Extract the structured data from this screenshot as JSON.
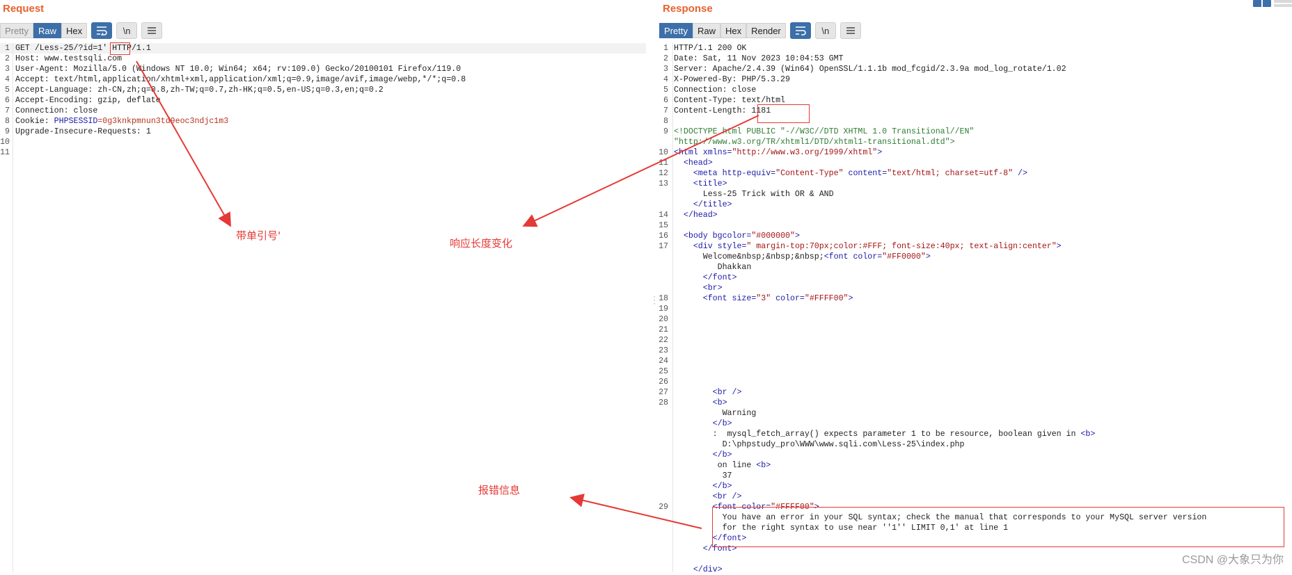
{
  "request": {
    "title": "Request",
    "tabs": {
      "pretty": "Pretty",
      "raw": "Raw",
      "hex": "Hex"
    },
    "tools": {
      "wrap": "wrap-lines-icon",
      "newline": "\\n",
      "menu": "menu-icon"
    },
    "lines": [
      {
        "n": "1",
        "parts": [
          {
            "t": "GET /Less-25/?id=1' HTTP/1.1"
          }
        ]
      },
      {
        "n": "2",
        "parts": [
          {
            "t": "Host: www.testsqli.com"
          }
        ]
      },
      {
        "n": "3",
        "parts": [
          {
            "t": "User-Agent: Mozilla/5.0 (Windows NT 10.0; Win64; x64; rv:109.0) Gecko/20100101 Firefox/119.0"
          }
        ]
      },
      {
        "n": "4",
        "parts": [
          {
            "t": "Accept: text/html,application/xhtml+xml,application/xml;q=0.9,image/avif,image/webp,*/*;q=0.8"
          }
        ]
      },
      {
        "n": "5",
        "parts": [
          {
            "t": "Accept-Language: zh-CN,zh;q=0.8,zh-TW;q=0.7,zh-HK;q=0.5,en-US;q=0.3,en;q=0.2"
          }
        ]
      },
      {
        "n": "6",
        "parts": [
          {
            "t": "Accept-Encoding: gzip, deflate"
          }
        ]
      },
      {
        "n": "7",
        "parts": [
          {
            "t": "Connection: close"
          }
        ]
      },
      {
        "n": "8",
        "parts": [
          {
            "t": "Cookie: "
          },
          {
            "t": "PHPSESSID",
            "c": "cookie-name"
          },
          {
            "t": "=0g3knkpmnun3td9eoc3ndjc1m3",
            "c": "cookie-val"
          }
        ]
      },
      {
        "n": "9",
        "parts": [
          {
            "t": "Upgrade-Insecure-Requests: 1"
          }
        ]
      },
      {
        "n": "10",
        "parts": []
      },
      {
        "n": "11",
        "parts": []
      }
    ]
  },
  "response": {
    "title": "Response",
    "tabs": {
      "pretty": "Pretty",
      "raw": "Raw",
      "hex": "Hex",
      "render": "Render"
    },
    "tools": {
      "wrap": "wrap-lines-icon",
      "newline": "\\n",
      "menu": "menu-icon"
    },
    "lines": [
      {
        "n": "1",
        "parts": [
          {
            "t": "HTTP/1.1 200 OK"
          }
        ]
      },
      {
        "n": "2",
        "parts": [
          {
            "t": "Date: Sat, 11 Nov 2023 10:04:53 GMT"
          }
        ]
      },
      {
        "n": "3",
        "parts": [
          {
            "t": "Server: Apache/2.4.39 (Win64) OpenSSL/1.1.1b mod_fcgid/2.3.9a mod_log_rotate/1.02"
          }
        ]
      },
      {
        "n": "4",
        "parts": [
          {
            "t": "X-Powered-By: PHP/5.3.29"
          }
        ]
      },
      {
        "n": "5",
        "parts": [
          {
            "t": "Connection: close"
          }
        ]
      },
      {
        "n": "6",
        "parts": [
          {
            "t": "Content-Type: text/html"
          }
        ]
      },
      {
        "n": "7",
        "parts": [
          {
            "t": "Content-Length: 1181"
          }
        ]
      },
      {
        "n": "8",
        "parts": []
      },
      {
        "n": "9",
        "parts": [
          {
            "t": "<!DOCTYPE html PUBLIC \"-//W3C//DTD XHTML 1.0 Transitional//EN\"",
            "c": "doctype"
          }
        ]
      },
      {
        "n": "",
        "parts": [
          {
            "t": "\"http://www.w3.org/TR/xhtml1/DTD/xhtml1-transitional.dtd\">",
            "c": "doctype"
          }
        ]
      },
      {
        "n": "10",
        "parts": [
          {
            "t": "<html ",
            "c": "tag"
          },
          {
            "t": "xmlns=",
            "c": "attr"
          },
          {
            "t": "\"http://www.w3.org/1999/xhtml\"",
            "c": "str"
          },
          {
            "t": ">",
            "c": "tag"
          }
        ]
      },
      {
        "n": "11",
        "parts": [
          {
            "t": "  "
          },
          {
            "t": "<head>",
            "c": "tag"
          }
        ]
      },
      {
        "n": "12",
        "parts": [
          {
            "t": "    "
          },
          {
            "t": "<meta ",
            "c": "tag"
          },
          {
            "t": "http-equiv=",
            "c": "attr"
          },
          {
            "t": "\"Content-Type\" ",
            "c": "str"
          },
          {
            "t": "content=",
            "c": "attr"
          },
          {
            "t": "\"text/html; charset=utf-8\"",
            "c": "str"
          },
          {
            "t": " />",
            "c": "tag"
          }
        ]
      },
      {
        "n": "13",
        "parts": [
          {
            "t": "    "
          },
          {
            "t": "<title>",
            "c": "tag"
          }
        ]
      },
      {
        "n": "",
        "parts": [
          {
            "t": "      Less-25 Trick with OR & AND"
          }
        ]
      },
      {
        "n": "",
        "parts": [
          {
            "t": "    "
          },
          {
            "t": "</title>",
            "c": "tag"
          }
        ]
      },
      {
        "n": "14",
        "parts": [
          {
            "t": "  "
          },
          {
            "t": "</head>",
            "c": "tag"
          }
        ]
      },
      {
        "n": "15",
        "parts": []
      },
      {
        "n": "16",
        "parts": [
          {
            "t": "  "
          },
          {
            "t": "<body ",
            "c": "tag"
          },
          {
            "t": "bgcolor=",
            "c": "attr"
          },
          {
            "t": "\"#000000\"",
            "c": "str"
          },
          {
            "t": ">",
            "c": "tag"
          }
        ]
      },
      {
        "n": "17",
        "parts": [
          {
            "t": "    "
          },
          {
            "t": "<div ",
            "c": "tag"
          },
          {
            "t": "style=",
            "c": "attr"
          },
          {
            "t": "\" margin-top:70px;color:#FFF; font-size:40px; text-align:center\"",
            "c": "str"
          },
          {
            "t": ">",
            "c": "tag"
          }
        ]
      },
      {
        "n": "",
        "parts": [
          {
            "t": "      Welcome&nbsp;&nbsp;&nbsp;"
          },
          {
            "t": "<font ",
            "c": "tag"
          },
          {
            "t": "color=",
            "c": "attr"
          },
          {
            "t": "\"#FF0000\"",
            "c": "str"
          },
          {
            "t": ">",
            "c": "tag"
          }
        ]
      },
      {
        "n": "",
        "parts": [
          {
            "t": "         Dhakkan"
          }
        ]
      },
      {
        "n": "",
        "parts": [
          {
            "t": "      "
          },
          {
            "t": "</font>",
            "c": "tag"
          }
        ]
      },
      {
        "n": "",
        "parts": [
          {
            "t": "      "
          },
          {
            "t": "<br>",
            "c": "tag"
          }
        ]
      },
      {
        "n": "18",
        "parts": [
          {
            "t": "      "
          },
          {
            "t": "<font ",
            "c": "tag"
          },
          {
            "t": "size=",
            "c": "attr"
          },
          {
            "t": "\"3\" ",
            "c": "str"
          },
          {
            "t": "color=",
            "c": "attr"
          },
          {
            "t": "\"#FFFF00\"",
            "c": "str"
          },
          {
            "t": ">",
            "c": "tag"
          }
        ]
      },
      {
        "n": "19",
        "parts": []
      },
      {
        "n": "20",
        "parts": []
      },
      {
        "n": "21",
        "parts": []
      },
      {
        "n": "22",
        "parts": []
      },
      {
        "n": "23",
        "parts": []
      },
      {
        "n": "24",
        "parts": []
      },
      {
        "n": "25",
        "parts": []
      },
      {
        "n": "26",
        "parts": []
      },
      {
        "n": "27",
        "parts": [
          {
            "t": "        "
          },
          {
            "t": "<br />",
            "c": "tag"
          }
        ]
      },
      {
        "n": "28",
        "parts": [
          {
            "t": "        "
          },
          {
            "t": "<b>",
            "c": "tag"
          }
        ]
      },
      {
        "n": "",
        "parts": [
          {
            "t": "          Warning"
          }
        ]
      },
      {
        "n": "",
        "parts": [
          {
            "t": "        "
          },
          {
            "t": "</b>",
            "c": "tag"
          }
        ]
      },
      {
        "n": "",
        "parts": [
          {
            "t": "        :  mysql_fetch_array() expects parameter 1 to be resource, boolean given in "
          },
          {
            "t": "<b>",
            "c": "tag"
          }
        ]
      },
      {
        "n": "",
        "parts": [
          {
            "t": "          D:\\phpstudy_pro\\WWW\\www.sqli.com\\Less-25\\index.php"
          }
        ]
      },
      {
        "n": "",
        "parts": [
          {
            "t": "        "
          },
          {
            "t": "</b>",
            "c": "tag"
          }
        ]
      },
      {
        "n": "",
        "parts": [
          {
            "t": "         on line "
          },
          {
            "t": "<b>",
            "c": "tag"
          }
        ]
      },
      {
        "n": "",
        "parts": [
          {
            "t": "          37"
          }
        ]
      },
      {
        "n": "",
        "parts": [
          {
            "t": "        "
          },
          {
            "t": "</b>",
            "c": "tag"
          }
        ]
      },
      {
        "n": "",
        "parts": [
          {
            "t": "        "
          },
          {
            "t": "<br />",
            "c": "tag"
          }
        ]
      },
      {
        "n": "29",
        "parts": [
          {
            "t": "        "
          },
          {
            "t": "<font ",
            "c": "tag"
          },
          {
            "t": "color=",
            "c": "attr"
          },
          {
            "t": "\"#FFFF00\"",
            "c": "str"
          },
          {
            "t": ">",
            "c": "tag"
          }
        ]
      },
      {
        "n": "",
        "parts": [
          {
            "t": "          You have an error in your SQL syntax; check the manual that corresponds to your MySQL server version"
          }
        ]
      },
      {
        "n": "",
        "parts": [
          {
            "t": "          for the right syntax to use near ''1'' LIMIT 0,1' at line 1"
          }
        ]
      },
      {
        "n": "",
        "parts": [
          {
            "t": "        "
          },
          {
            "t": "</font>",
            "c": "tag"
          }
        ]
      },
      {
        "n": "",
        "parts": [
          {
            "t": "      "
          },
          {
            "t": "</font>",
            "c": "tag"
          }
        ]
      },
      {
        "n": "",
        "parts": []
      },
      {
        "n": "",
        "parts": [
          {
            "t": "    "
          },
          {
            "t": "</div>",
            "c": "tag"
          }
        ]
      }
    ]
  },
  "annotations": {
    "single_quote": "带单引号'",
    "length_change": "响应长度变化",
    "error_info": "报错信息"
  },
  "watermark": "CSDN @大象只为你",
  "colors": {
    "accent": "#e8612c",
    "active_tab": "#3d6fa8",
    "annotation": "#e53935"
  }
}
